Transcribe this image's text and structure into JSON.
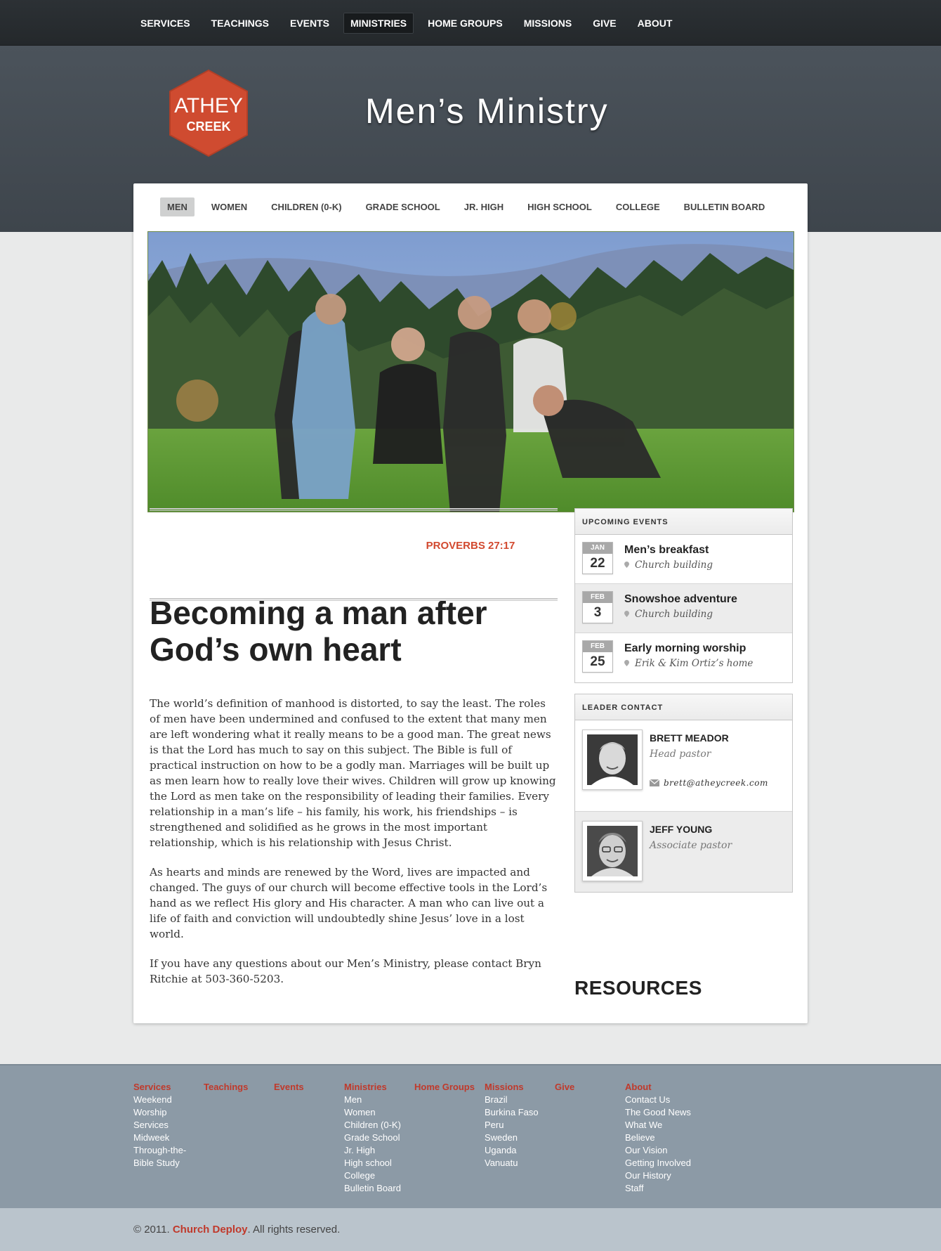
{
  "top_nav": {
    "items": [
      {
        "label": "SERVICES",
        "active": false
      },
      {
        "label": "TEACHINGS",
        "active": false
      },
      {
        "label": "EVENTS",
        "active": false
      },
      {
        "label": "MINISTRIES",
        "active": true
      },
      {
        "label": "HOME GROUPS",
        "active": false
      },
      {
        "label": "MISSIONS",
        "active": false
      },
      {
        "label": "GIVE",
        "active": false
      },
      {
        "label": "ABOUT",
        "active": false
      }
    ]
  },
  "logo": {
    "line1": "ATHEY",
    "line2": "CREEK",
    "color": "#cf4b30"
  },
  "header": {
    "title": "Men’s Ministry"
  },
  "sub_nav": {
    "items": [
      {
        "label": "MEN",
        "active": true
      },
      {
        "label": "WOMEN",
        "active": false
      },
      {
        "label": "CHILDREN (0-K)",
        "active": false
      },
      {
        "label": "GRADE SCHOOL",
        "active": false
      },
      {
        "label": "JR. HIGH",
        "active": false
      },
      {
        "label": "HIGH SCHOOL",
        "active": false
      },
      {
        "label": "COLLEGE",
        "active": false
      },
      {
        "label": "BULLETIN BOARD",
        "active": false
      }
    ]
  },
  "verse": "PROVERBS 27:17",
  "article": {
    "headline": "Becoming a man after God’s own heart",
    "paragraphs": [
      "The world’s definition of manhood is distorted, to say the least. The roles of men have been undermined and confused to the extent that many men are left wondering what it really means to be a good man. The great news is that the Lord has much to say on this subject. The Bible is full of practical instruction on how to be a godly man. Marriages will be built up as men learn how to really love their wives. Children will grow up knowing the Lord as men take on the responsibility of leading their families. Every relationship in a man’s life – his family, his work, his friendships – is strengthened and solidified as he grows in the most important relationship, which is his relationship with Jesus Christ.",
      "As hearts and minds are renewed by the Word, lives are impacted and changed. The guys of our church will become effective tools in the Lord’s hand as we reflect His glory and His character. A man who can live out a life of faith and conviction will undoubtedly shine Jesus’ love in a lost world.",
      "If you have any questions about our Men’s Ministry, please contact Bryn Ritchie at 503-360-5203."
    ]
  },
  "upcoming_events": {
    "heading": "UPCOMING EVENTS",
    "items": [
      {
        "month": "JAN",
        "day": "22",
        "title": "Men’s breakfast",
        "location": "Church building"
      },
      {
        "month": "FEB",
        "day": "3",
        "title": "Snowshoe adventure",
        "location": "Church building"
      },
      {
        "month": "FEB",
        "day": "25",
        "title": "Early morning worship",
        "location": "Erik & Kim Ortiz’s home"
      }
    ]
  },
  "leader_contact": {
    "heading": "LEADER CONTACT",
    "leaders": [
      {
        "name": "BRETT MEADOR",
        "role": "Head pastor",
        "email": "brett@atheycreek.com"
      },
      {
        "name": "JEFF YOUNG",
        "role": "Associate pastor"
      }
    ]
  },
  "resources_heading": "RESOURCES",
  "footer": {
    "columns": [
      {
        "heading": "Services",
        "items": [
          "Weekend",
          "Worship",
          "Services",
          "Midweek",
          "Through-the-",
          "Bible Study"
        ]
      },
      {
        "heading": "Teachings",
        "items": []
      },
      {
        "heading": "Events",
        "items": []
      },
      {
        "heading": "Ministries",
        "items": [
          "Men",
          "Women",
          "Children (0-K)",
          "Grade School",
          "Jr. High",
          "High school",
          "College",
          "Bulletin Board"
        ]
      },
      {
        "heading": "Home Groups",
        "items": []
      },
      {
        "heading": "Missions",
        "items": [
          "Brazil",
          "Burkina Faso",
          "Peru",
          "Sweden",
          "Uganda",
          "Vanuatu"
        ]
      },
      {
        "heading": "Give",
        "items": []
      },
      {
        "heading": "About",
        "items": [
          "Contact Us",
          "The Good News",
          "What We",
          "Believe",
          "Our Vision",
          "Getting Involved",
          "Our History",
          "Staff"
        ]
      }
    ]
  },
  "copyright": {
    "prefix": "© 2011.",
    "brand": "Church Deploy",
    "suffix": ". All rights reserved."
  }
}
